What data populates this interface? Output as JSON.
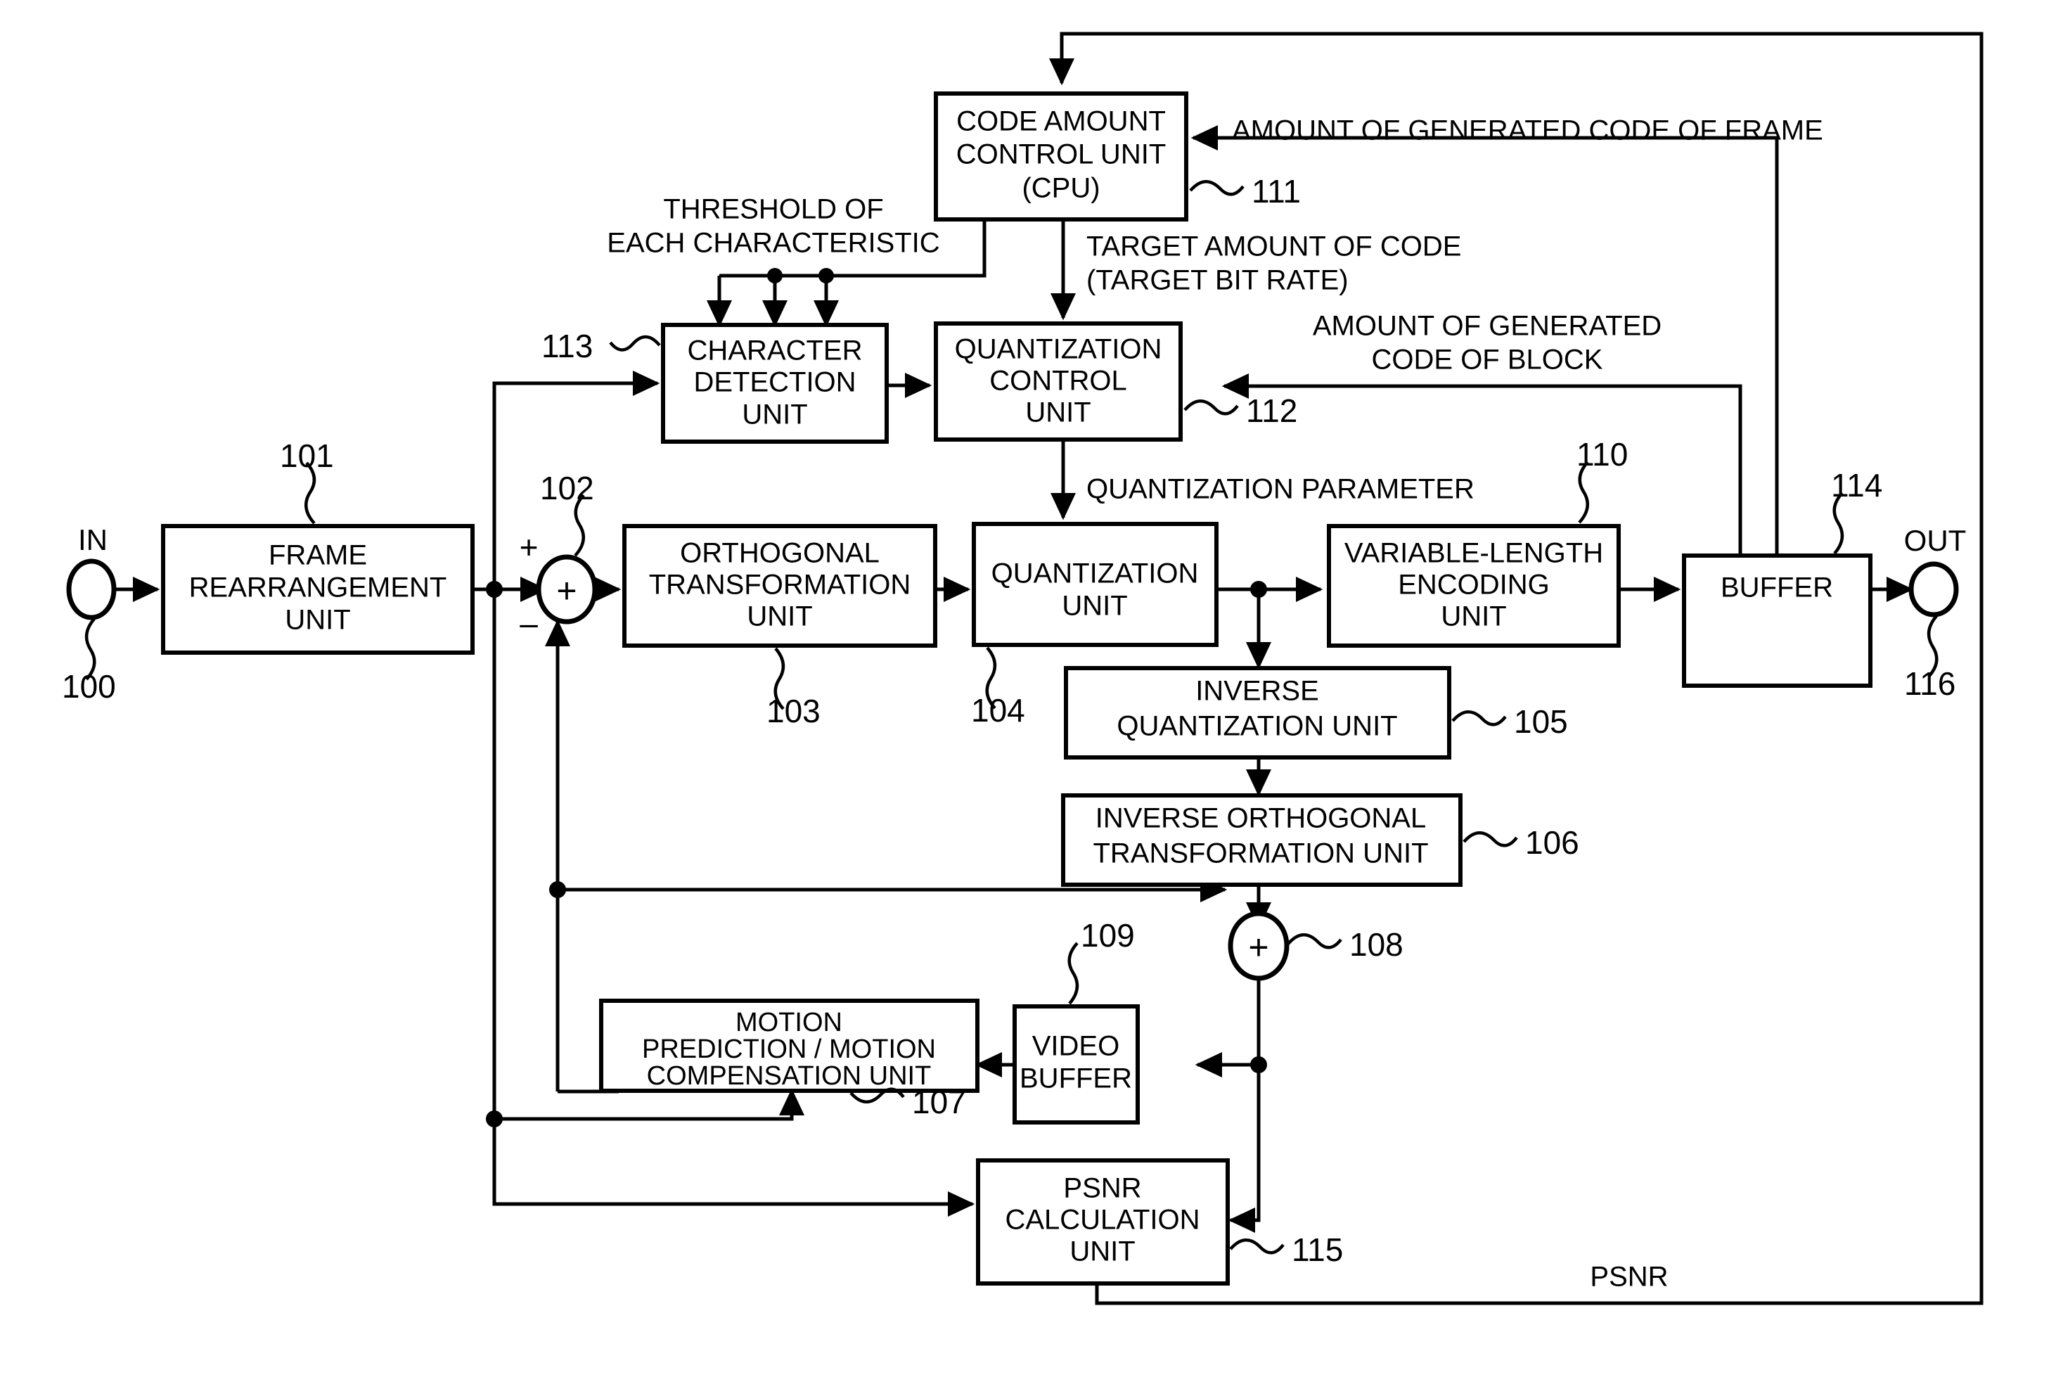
{
  "figure": {
    "type": "block-diagram",
    "title": "Video encoding apparatus block diagram"
  },
  "io": {
    "in_label": "IN",
    "in_ref": "100",
    "out_label": "OUT",
    "out_ref": "116"
  },
  "blocks": [
    {
      "id": "frame_rearrangement",
      "lines": [
        "FRAME",
        "REARRANGEMENT",
        "UNIT"
      ],
      "ref": "101"
    },
    {
      "id": "orthogonal_transformation",
      "lines": [
        "ORTHOGONAL",
        "TRANSFORMATION",
        "UNIT"
      ],
      "ref": "103"
    },
    {
      "id": "quantization",
      "lines": [
        "QUANTIZATION",
        "UNIT"
      ],
      "ref": "104"
    },
    {
      "id": "variable_length_encoding",
      "lines": [
        "VARIABLE-LENGTH",
        "ENCODING",
        "UNIT"
      ],
      "ref": "110"
    },
    {
      "id": "buffer",
      "lines": [
        "BUFFER"
      ],
      "ref": "114"
    },
    {
      "id": "inverse_quantization",
      "lines": [
        "INVERSE",
        "QUANTIZATION UNIT"
      ],
      "ref": "105"
    },
    {
      "id": "inverse_orthogonal_transformation",
      "lines": [
        "INVERSE ORTHOGONAL",
        "TRANSFORMATION UNIT"
      ],
      "ref": "106"
    },
    {
      "id": "motion_prediction_compensation",
      "lines": [
        "MOTION",
        "PREDICTION / MOTION",
        "COMPENSATION UNIT"
      ],
      "ref": "107"
    },
    {
      "id": "video_buffer",
      "lines": [
        "VIDEO",
        "BUFFER"
      ],
      "ref": "109"
    },
    {
      "id": "psnr_calculation",
      "lines": [
        "PSNR",
        "CALCULATION",
        "UNIT"
      ],
      "ref": "115"
    },
    {
      "id": "code_amount_control",
      "lines": [
        "CODE AMOUNT",
        "CONTROL UNIT",
        "(CPU)"
      ],
      "ref": "111"
    },
    {
      "id": "character_detection",
      "lines": [
        "CHARACTER",
        "DETECTION",
        "UNIT"
      ],
      "ref": "113"
    },
    {
      "id": "quantization_control",
      "lines": [
        "QUANTIZATION",
        "CONTROL",
        "UNIT"
      ],
      "ref": "112"
    }
  ],
  "block_text": {
    "frame_rearrangement": {
      "l1": "FRAME",
      "l2": "REARRANGEMENT",
      "l3": "UNIT",
      "ref": "101"
    },
    "orthogonal_transformation": {
      "l1": "ORTHOGONAL",
      "l2": "TRANSFORMATION",
      "l3": "UNIT",
      "ref": "103"
    },
    "quantization": {
      "l1": "QUANTIZATION",
      "l2": "UNIT",
      "ref": "104"
    },
    "variable_length_encoding": {
      "l1": "VARIABLE-LENGTH",
      "l2": "ENCODING",
      "l3": "UNIT",
      "ref": "110"
    },
    "buffer": {
      "l1": "BUFFER",
      "ref": "114"
    },
    "inverse_quantization": {
      "l1": "INVERSE",
      "l2": "QUANTIZATION UNIT",
      "ref": "105"
    },
    "inverse_orthogonal_transformation": {
      "l1": "INVERSE ORTHOGONAL",
      "l2": "TRANSFORMATION UNIT",
      "ref": "106"
    },
    "motion_prediction_compensation": {
      "l1": "MOTION",
      "l2": "PREDICTION / MOTION",
      "l3": "COMPENSATION UNIT",
      "ref": "107"
    },
    "video_buffer": {
      "l1": "VIDEO",
      "l2": "BUFFER",
      "ref": "109"
    },
    "psnr_calculation": {
      "l1": "PSNR",
      "l2": "CALCULATION",
      "l3": "UNIT",
      "ref": "115"
    },
    "code_amount_control": {
      "l1": "CODE AMOUNT",
      "l2": "CONTROL UNIT",
      "l3": "(CPU)",
      "ref": "111"
    },
    "character_detection": {
      "l1": "CHARACTER",
      "l2": "DETECTION",
      "l3": "UNIT",
      "ref": "113"
    },
    "quantization_control": {
      "l1": "QUANTIZATION",
      "l2": "CONTROL",
      "l3": "UNIT",
      "ref": "112"
    }
  },
  "adders": {
    "subtractor": {
      "ref": "102",
      "glyph": "+",
      "plus_sign": "+",
      "minus_sign": "–"
    },
    "summer": {
      "ref": "108",
      "glyph": "+"
    }
  },
  "signals": {
    "threshold": {
      "l1": "THRESHOLD OF",
      "l2": "EACH CHARACTERISTIC"
    },
    "amount_generated_code_frame": "AMOUNT OF GENERATED CODE OF FRAME",
    "target_amount_of_code": {
      "l1": "TARGET AMOUNT OF CODE",
      "l2": "(TARGET BIT RATE)"
    },
    "amount_generated_code_block": {
      "l1": "AMOUNT OF GENERATED",
      "l2": "CODE OF BLOCK"
    },
    "quantization_parameter": "QUANTIZATION PARAMETER",
    "psnr": "PSNR"
  },
  "colors": {
    "stroke": "#000000",
    "fill": "#ffffff"
  }
}
